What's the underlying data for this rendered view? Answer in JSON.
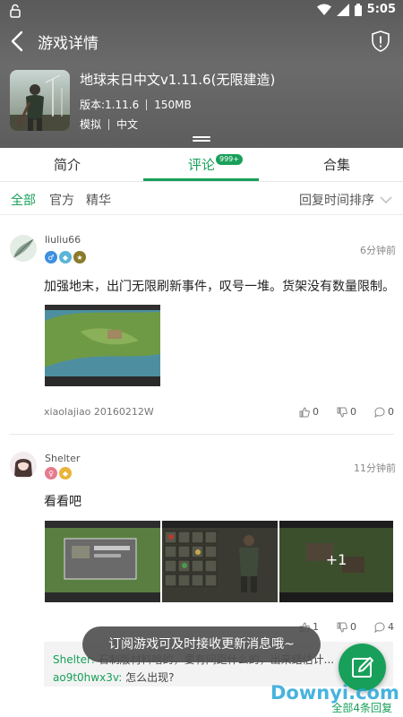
{
  "status_bar": {
    "time": "5:05"
  },
  "nav": {
    "title": "游戏详情"
  },
  "game": {
    "name": "地球末日中文v1.11.6(无限建造)",
    "version": "版本:1.11.6",
    "size": "150MB",
    "tag1": "模拟",
    "tag2": "中文"
  },
  "tabs": [
    {
      "label": "简介"
    },
    {
      "label": "评论",
      "badge": "999+"
    },
    {
      "label": "合集"
    }
  ],
  "filters": {
    "items": [
      "全部",
      "官方",
      "精华"
    ],
    "sort": "回复时间排序"
  },
  "comments": [
    {
      "user": "liuliu66",
      "time": "6分钟前",
      "text": "加强地末，出门无限刷新事件，叹号一堆。货架没有数量限制。",
      "device": "xiaolajiao 20160212W",
      "likes": "0",
      "dislikes": "0",
      "replies": "0"
    },
    {
      "user": "Shelter",
      "time": "11分钟前",
      "text": "看看吧",
      "more_images": "+1",
      "likes": "1",
      "dislikes": "0",
      "replies": "4",
      "reply_preview": {
        "line1_user": "Shelter:",
        "line1_text": "石制版材料啥的，要有间距什么的，出来结估计...",
        "line2_user": "ao9t0hwx3v:",
        "line2_text": "怎么出现?"
      },
      "reply_all": "全部4条回复"
    }
  ],
  "toast": "订阅游戏可及时接收更新消息哦~",
  "watermark": "Downyi.com",
  "colors": {
    "accent": "#18a05a",
    "header": "#616161"
  }
}
